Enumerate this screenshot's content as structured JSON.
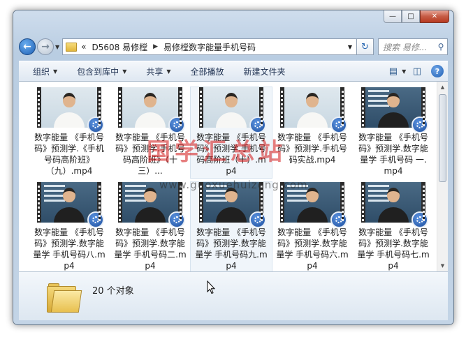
{
  "address": {
    "overflow": "«",
    "crumbs": [
      "D5608 易修樘",
      "易修樘数字能量手机号码"
    ]
  },
  "search": {
    "placeholder": "搜索 易修..."
  },
  "toolbar": {
    "organize": "组织",
    "include_in_library": "包含到库中",
    "share": "共享",
    "play_all": "全部播放",
    "new_folder": "新建文件夹"
  },
  "files": [
    {
      "name": "数字能量 《手机号码》预测学.《手机号码高阶班》（九）.mp4",
      "style": "bright",
      "shirt": "white"
    },
    {
      "name": "数字能量 《手机号码》预测学.手机号码高阶班》（十三）...",
      "style": "bright",
      "shirt": "white"
    },
    {
      "name": "数字能量 《手机号码》预测学.手机号码高阶班（十）.mp4",
      "style": "bright",
      "shirt": "white"
    },
    {
      "name": "数字能量 《手机号码》预测学.手机号码实战.mp4",
      "style": "bright",
      "shirt": "white"
    },
    {
      "name": "数字能量 《手机号码》预测学.数字能量学 手机号码 一.mp4",
      "style": "board",
      "shirt": "black"
    },
    {
      "name": "数字能量 《手机号码》预测学.数字能量学 手机号码八.mp4",
      "style": "board",
      "shirt": "black"
    },
    {
      "name": "数字能量 《手机号码》预测学.数字能量学 手机号码二.mp4",
      "style": "board",
      "shirt": "black"
    },
    {
      "name": "数字能量 《手机号码》预测学.数字能量学 手机号码九.mp4",
      "style": "board",
      "shirt": "black"
    },
    {
      "name": "数字能量 《手机号码》预测学.数字能量学 手机号码六.mp4",
      "style": "board",
      "shirt": "black"
    },
    {
      "name": "数字能量 《手机号码》预测学.数字能量学 手机号码七.mp4",
      "style": "board",
      "shirt": "black"
    }
  ],
  "status": {
    "count": "20 个对象"
  },
  "watermark": {
    "text": "国学汇总站",
    "url": "www.guoxuehuizong.com"
  },
  "colors": {
    "accent": "#1f5fb3",
    "watermark": "#d21414"
  }
}
